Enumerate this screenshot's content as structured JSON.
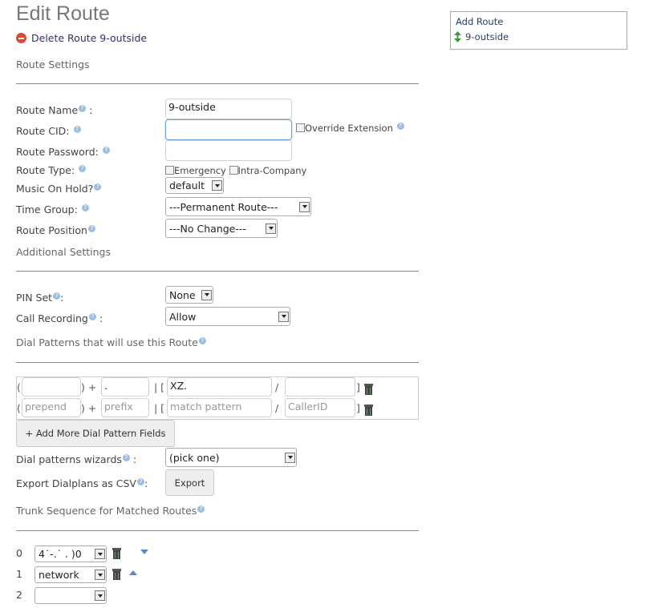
{
  "page": {
    "title": "Edit Route",
    "delete_link": "Delete Route 9-outside"
  },
  "sections": {
    "route_settings": "Route Settings",
    "additional_settings": "Additional Settings",
    "dial_patterns": "Dial Patterns that will use this Route",
    "trunk_sequence": "Trunk Sequence for Matched Routes"
  },
  "form": {
    "route_name": {
      "label": "Route Name",
      "suffix": ":",
      "value": "9-outside"
    },
    "route_cid": {
      "label": "Route CID:",
      "value": "",
      "override_label": "Override Extension"
    },
    "route_password": {
      "label": "Route Password:",
      "value": ""
    },
    "route_type": {
      "label": "Route Type:",
      "emergency": "Emergency",
      "intra_company": "Intra-Company"
    },
    "music_on_hold": {
      "label": "Music On Hold?",
      "value": "default"
    },
    "time_group": {
      "label": "Time Group:",
      "value": "---Permanent Route---"
    },
    "route_position": {
      "label": "Route Position",
      "value": "---No Change---"
    },
    "pin_set": {
      "label": "PIN Set",
      "suffix": ":",
      "value": "None"
    },
    "call_recording": {
      "label": "Call Recording",
      "suffix": ":",
      "value": "Allow"
    }
  },
  "dial_patterns": {
    "rows": [
      {
        "prepend": "",
        "prefix": ".",
        "match": "XZ.",
        "callerid": ""
      },
      {
        "prepend_ph": "prepend",
        "prefix_ph": "prefix",
        "match_ph": "match pattern",
        "callerid_ph": "CallerID"
      }
    ],
    "sym_open": "(",
    "sym_close_plus": ") +",
    "sym_pipe": "| [",
    "sym_slash": "/",
    "sym_close": "]",
    "add_more_button": "+ Add More Dial Pattern Fields",
    "wizard_label": "Dial patterns wizards",
    "wizard_value": "(pick one)",
    "export_label": "Export Dialplans as CSV",
    "export_button": "Export"
  },
  "trunks": [
    {
      "index": "0",
      "value": "4˙-.˙ . )0"
    },
    {
      "index": "1",
      "value": "network"
    },
    {
      "index": "2",
      "value": ""
    }
  ],
  "sidebar": {
    "add_route": "Add Route",
    "routes": [
      "9-outside"
    ]
  },
  "colors": {
    "link": "#3d2a6b",
    "help_icon": "#9bbfe3",
    "delete_icon": "#d94a38"
  }
}
